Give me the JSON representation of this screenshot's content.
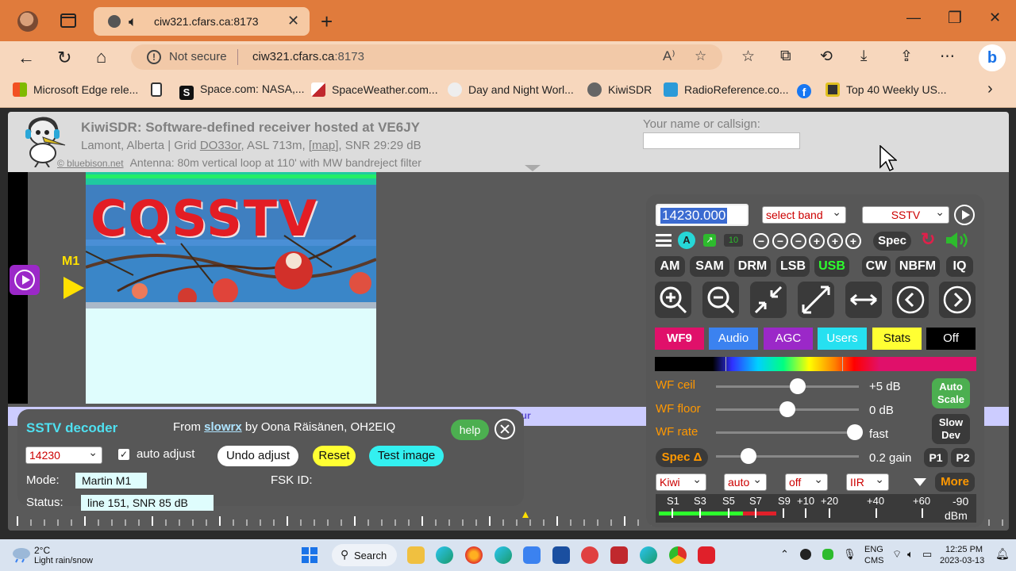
{
  "browser": {
    "tab_title": "ciw321.cfars.ca:8173",
    "security_label": "Not secure",
    "url_host": "ciw321.cfars.ca",
    "url_port": ":8173",
    "bookmarks": [
      "Microsoft Edge rele...",
      "Space.com: NASA,...",
      "SpaceWeather.com...",
      "Day and Night Worl...",
      "KiwiSDR",
      "RadioReference.co...",
      "Top 40 Weekly US..."
    ]
  },
  "site": {
    "title": "KiwiSDR: Software-defined receiver hosted at VE6JY",
    "loc_a": "Lamont, Alberta | Grid ",
    "grid": "DO33or",
    "loc_b": ", ASL 713m, [",
    "map": "map",
    "loc_c": "], SNR 29:29 dB",
    "credit": "© bluebison.net",
    "antenna": "Antenna: 80m vertical loop at 110' with MW bandreject filter",
    "name_label": "Your name or callsign:",
    "name_value": ""
  },
  "waterfall": {
    "marker": "M1",
    "image_text": "CQSSTV",
    "freqbar_label": "eur"
  },
  "sstv": {
    "title": "SSTV decoder",
    "from_prefix": "From ",
    "from_link": "slowrx",
    "from_suffix": " by Oona Räisänen, OH2EIQ",
    "help": "help",
    "freq_select": "14230",
    "auto_adjust_label": "auto adjust",
    "auto_adjust_checked": true,
    "undo": "Undo adjust",
    "reset": "Reset",
    "test": "Test image",
    "mode_label": "Mode:",
    "mode_value": "Martin M1",
    "fsk_label": "FSK ID:",
    "status_label": "Status:",
    "status_value": "line 151, SNR 85 dB"
  },
  "control": {
    "frequency": "14230.000",
    "band_select": "select band",
    "mode_select": "SSTV",
    "a_label": "A",
    "ten_label": "10",
    "spec": "Spec",
    "modes": [
      "AM",
      "SAM",
      "DRM",
      "LSB",
      "USB",
      "CW",
      "NBFM",
      "IQ"
    ],
    "active_mode": "USB",
    "tabs": [
      "WF9",
      "Audio",
      "AGC",
      "Users",
      "Stats",
      "Off"
    ],
    "wf_ceil_label": "WF ceil",
    "wf_ceil_value": "+5 dB",
    "wf_ceil_pos": 0.57,
    "wf_floor_label": "WF floor",
    "wf_floor_value": "0 dB",
    "wf_floor_pos": 0.5,
    "wf_rate_label": "WF rate",
    "wf_rate_value": "fast",
    "wf_rate_pos": 0.97,
    "spec_delta": "Spec Δ",
    "gain_value": "0.2 gain",
    "gain_pos": 0.23,
    "auto_scale": "Auto Scale",
    "slow_dev": "Slow Dev",
    "p1": "P1",
    "p2": "P2",
    "kiwi_select": "Kiwi",
    "auto_select": "auto",
    "off_select": "off",
    "iir_select": "IIR",
    "more": "More",
    "meter_labels": [
      "S1",
      "S3",
      "S5",
      "S7",
      "S9",
      "+10",
      "+20",
      "+40",
      "+60"
    ],
    "meter_value": "-90",
    "meter_unit": "dBm"
  },
  "taskbar": {
    "temp": "2°C",
    "weather": "Light rain/snow",
    "search": "Search",
    "lang": "ENG",
    "kb": "CMS",
    "time": "12:25 PM",
    "date": "2023-03-13"
  }
}
